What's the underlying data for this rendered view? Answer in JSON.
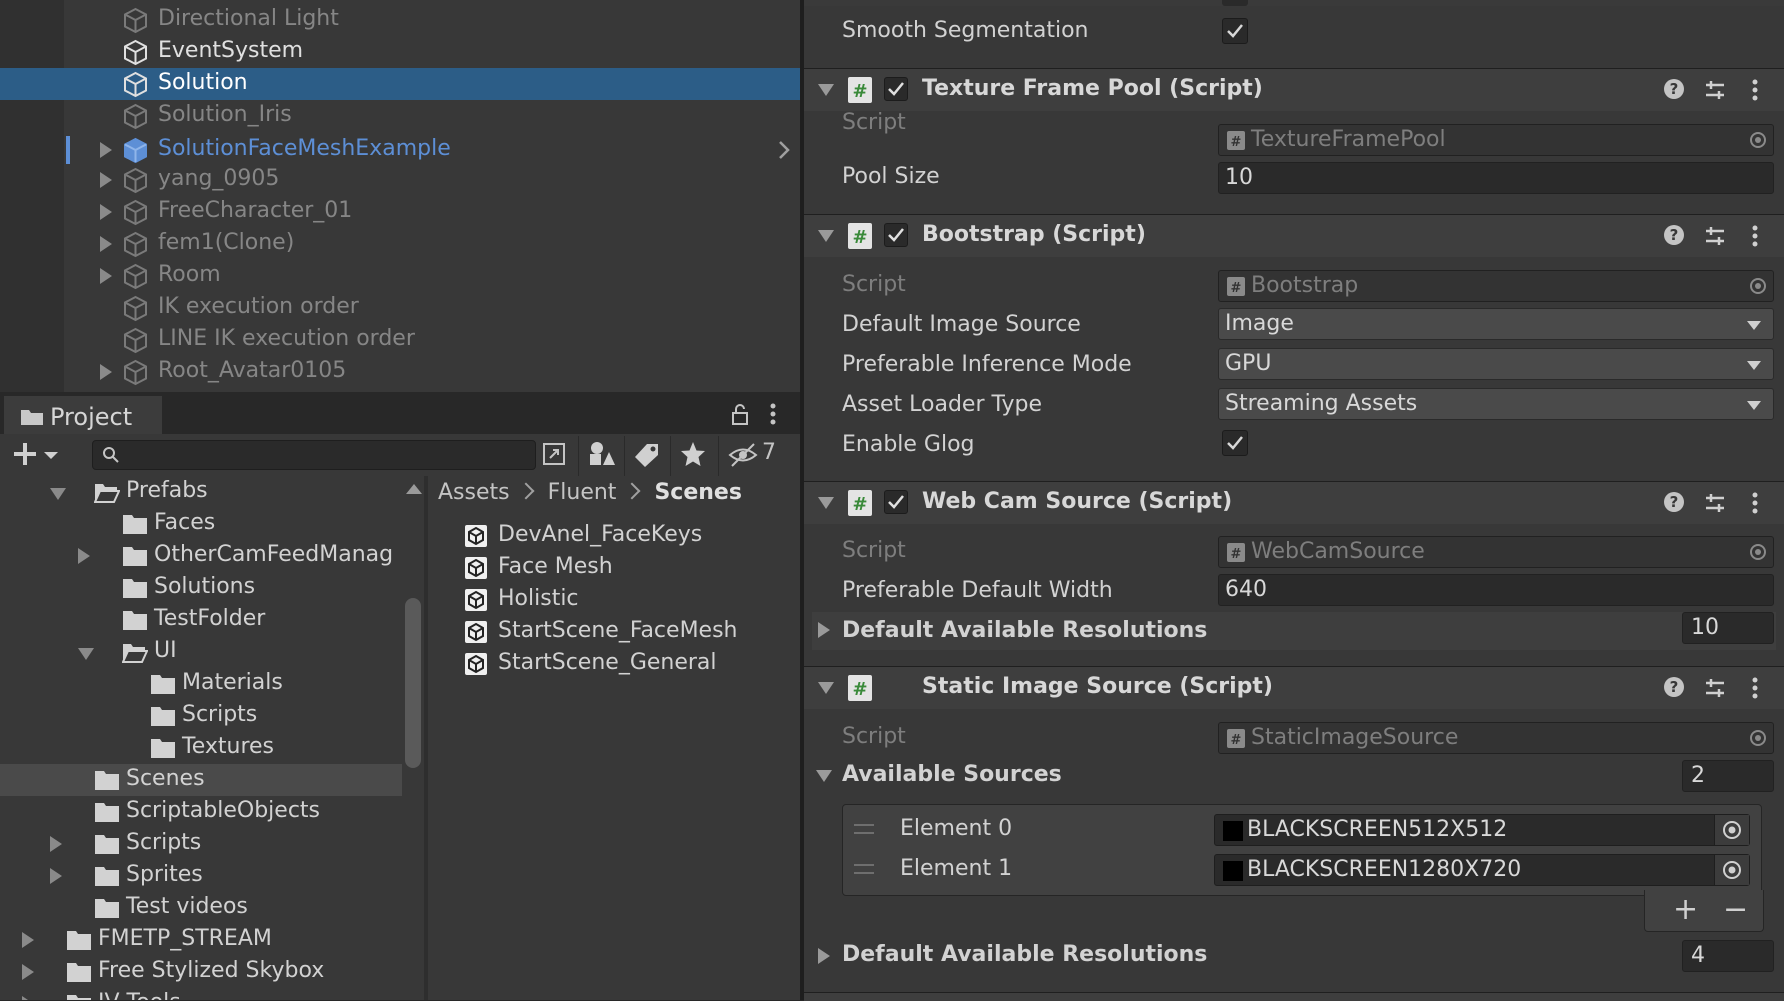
{
  "hierarchy": {
    "items": [
      {
        "label": "Directional Light",
        "state": "dim"
      },
      {
        "label": "EventSystem",
        "state": "bright"
      },
      {
        "label": "Solution",
        "state": "selected"
      },
      {
        "label": "Solution_Iris",
        "state": "dim"
      },
      {
        "label": "SolutionFaceMeshExample",
        "state": "prefab"
      },
      {
        "label": "yang_0905",
        "state": "dim"
      },
      {
        "label": "FreeCharacter_01",
        "state": "dim"
      },
      {
        "label": "fem1(Clone)",
        "state": "dim"
      },
      {
        "label": "Room",
        "state": "dim"
      },
      {
        "label": "IK execution order",
        "state": "dim"
      },
      {
        "label": "LINE IK execution order",
        "state": "dim"
      },
      {
        "label": "Root_Avatar0105",
        "state": "dim"
      }
    ]
  },
  "project": {
    "tab_label": "Project",
    "hidden_count": "7",
    "search_value": "",
    "breadcrumb": [
      "Assets",
      "Fluent",
      "Scenes"
    ],
    "tree": [
      {
        "label": "Prefabs"
      },
      {
        "label": "Faces"
      },
      {
        "label": "OtherCamFeedManag"
      },
      {
        "label": "Solutions"
      },
      {
        "label": "TestFolder"
      },
      {
        "label": "UI"
      },
      {
        "label": "Materials"
      },
      {
        "label": "Scripts"
      },
      {
        "label": "Textures"
      },
      {
        "label": "Scenes"
      },
      {
        "label": "ScriptableObjects"
      },
      {
        "label": "Scripts"
      },
      {
        "label": "Sprites"
      },
      {
        "label": "Test videos"
      },
      {
        "label": "FMETP_STREAM"
      },
      {
        "label": "Free Stylized Skybox"
      },
      {
        "label": "IV Tools"
      }
    ],
    "assets": [
      {
        "label": "DevAnel_FaceKeys"
      },
      {
        "label": "Face Mesh"
      },
      {
        "label": "Holistic"
      },
      {
        "label": "StartScene_FaceMesh"
      },
      {
        "label": "StartScene_General"
      }
    ]
  },
  "inspector": {
    "top_prop": {
      "label": "Smooth Segmentation",
      "checked": true
    },
    "texture_frame_pool": {
      "title": "Texture Frame Pool (Script)",
      "script_label": "Script",
      "script_value": "TextureFramePool",
      "pool_size_label": "Pool Size",
      "pool_size_value": "10"
    },
    "bootstrap": {
      "title": "Bootstrap (Script)",
      "script_label": "Script",
      "script_value": "Bootstrap",
      "image_source_label": "Default Image Source",
      "image_source_value": "Image",
      "inference_label": "Preferable Inference Mode",
      "inference_value": "GPU",
      "loader_label": "Asset Loader Type",
      "loader_value": "Streaming Assets",
      "glog_label": "Enable Glog"
    },
    "webcam": {
      "title": "Web Cam Source (Script)",
      "script_label": "Script",
      "script_value": "WebCamSource",
      "width_label": "Preferable Default Width",
      "width_value": "640",
      "resolutions_label": "Default Available Resolutions",
      "resolutions_size": "10"
    },
    "static_image": {
      "title": "Static Image Source (Script)",
      "script_label": "Script",
      "script_value": "StaticImageSource",
      "sources_label": "Available Sources",
      "sources_size": "2",
      "elements": [
        {
          "label": "Element 0",
          "value": "BLACKSCREEN512X512"
        },
        {
          "label": "Element 1",
          "value": "BLACKSCREEN1280X720"
        }
      ],
      "resolutions_label": "Default Available Resolutions",
      "resolutions_size": "4"
    },
    "glyphs": {
      "help": "?",
      "plus": "+",
      "minus": "−"
    }
  },
  "colors": {
    "selection": "#2c5d87",
    "prefab_text": "#5d8fd6",
    "panel_bg": "#383838",
    "script_icon": "#5fb85f"
  }
}
